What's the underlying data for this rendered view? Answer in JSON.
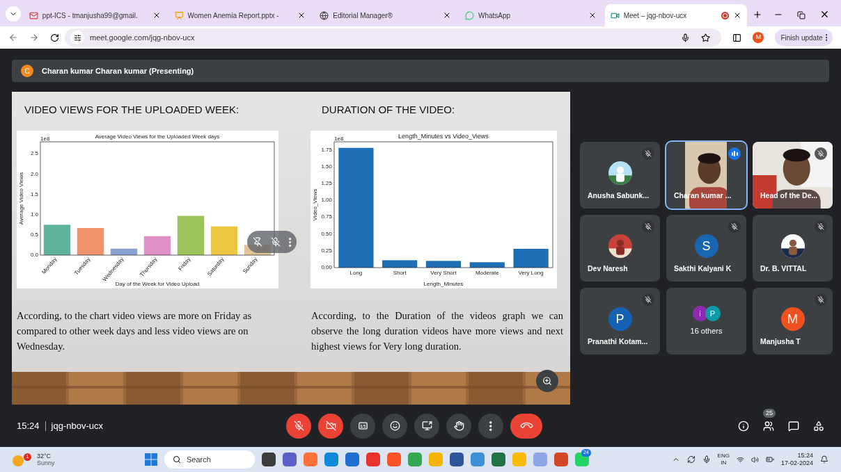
{
  "browser": {
    "tabs": [
      {
        "title": "ppt-ICS - tmanjusha99@gmail.",
        "kind": "mail",
        "selected": false
      },
      {
        "title": "Women Anemia Report.pptx -",
        "kind": "slides",
        "selected": false
      },
      {
        "title": "Editorial Manager®",
        "kind": "globe",
        "selected": false
      },
      {
        "title": "WhatsApp",
        "kind": "chat",
        "selected": false
      },
      {
        "title": "Meet – jqg-nbov-ucx",
        "kind": "meet",
        "selected": true,
        "recording": true
      }
    ],
    "url": "meet.google.com/jqg-nbov-ucx",
    "profile": "M",
    "update_button": "Finish update"
  },
  "presenter": {
    "initial": "C",
    "label": "Charan kumar Charan kumar (Presenting)"
  },
  "slide": {
    "sections": [
      {
        "heading": "VIDEO VIEWS FOR THE UPLOADED WEEK:",
        "body": "According, to the chart video views are more on Friday as compared to other week days and less video views are on Wednesday.",
        "justify": false,
        "chart_data": {
          "type": "bar",
          "title": "Average Video Views for the Uploaded Week days",
          "xlabel": "Day of the Week for Video Upload",
          "ylabel": "Average Video Views",
          "annotations": [
            {
              "text": "1e8"
            }
          ],
          "categories": [
            "Monday",
            "Tuesday",
            "Wednesday",
            "Thursday",
            "Friday",
            "Saturday",
            "Sunday"
          ],
          "series": [
            {
              "values": [
                0.75,
                0.67,
                0.16,
                0.47,
                0.97,
                0.71,
                0.25
              ]
            }
          ],
          "colors": [
            "#5fb49c",
            "#f0926a",
            "#8aa2cf",
            "#e092c8",
            "#9bc55a",
            "#eec740",
            "#e3c496"
          ],
          "ylim": [
            0,
            2.8
          ],
          "yticks": [
            {
              "value": 0,
              "label": "0.0"
            },
            {
              "value": 0.5,
              "label": "0.5"
            },
            {
              "value": 1,
              "label": "1.0"
            },
            {
              "value": 1.5,
              "label": "1.5"
            },
            {
              "value": 2,
              "label": "2.0"
            },
            {
              "value": 2.5,
              "label": "2.5"
            }
          ]
        }
      },
      {
        "heading": "DURATION OF THE VIDEO:",
        "body": "According, to the Duration of the videos graph we can observe the long duration videos have more views and next highest views for Very long duration.",
        "justify": true,
        "chart_data": {
          "type": "bar",
          "title": "Length_Minutes vs Video_Views",
          "xlabel": "Length_Minutes",
          "ylabel": "Video_Views",
          "annotations": [
            {
              "text": "1e8"
            }
          ],
          "categories": [
            "Long",
            "Short",
            "Very Short",
            "Moderate",
            "Very Long"
          ],
          "series": [
            {
              "color": "#1f6fb4",
              "values": [
                1.78,
                0.11,
                0.1,
                0.08,
                0.28
              ]
            }
          ],
          "ylim": [
            0,
            1.87
          ],
          "yticks": [
            {
              "value": 0,
              "label": "0.00"
            },
            {
              "value": 0.25,
              "label": "0.25"
            },
            {
              "value": 0.5,
              "label": "0.50"
            },
            {
              "value": 0.75,
              "label": "0.75"
            },
            {
              "value": 1,
              "label": "1.00"
            },
            {
              "value": 1.25,
              "label": "1.25"
            },
            {
              "value": 1.5,
              "label": "1.50"
            },
            {
              "value": 1.75,
              "label": "1.75"
            }
          ]
        }
      }
    ]
  },
  "participants": [
    {
      "name": "Anusha Sabunk...",
      "muted": true,
      "speaking": false
    },
    {
      "name": "Charan kumar ...",
      "kind": "video",
      "muted": false,
      "speaking": true
    },
    {
      "name": "Head of the De...",
      "kind": "fullvideo",
      "muted": true,
      "speaking": false
    },
    {
      "name": "Dev Naresh",
      "muted": true,
      "speaking": false
    },
    {
      "name": "Sakthi Kalyani K",
      "kind": "letter",
      "initial": "S",
      "color": "#1a65b0",
      "muted": true,
      "speaking": false
    },
    {
      "name": "Dr. B. VITTAL",
      "muted": true,
      "speaking": false
    },
    {
      "name": "Pranathi Kotam...",
      "kind": "letter",
      "initial": "P",
      "color": "#1561b3",
      "muted": true,
      "speaking": false
    },
    {
      "name": "16 others",
      "kind": "others",
      "avatars": [
        {
          "initial": "i",
          "color": "#8e2ab0"
        },
        {
          "initial": "P",
          "color": "#0f9aa8"
        }
      ],
      "muted": false,
      "speaking": false
    },
    {
      "name": "Manjusha T",
      "kind": "letter",
      "initial": "M",
      "color": "#f0511e",
      "muted": true,
      "speaking": false
    }
  ],
  "toolbar": {
    "time": "15:24",
    "meeting_code": "jqg-nbov-ucx",
    "people_count": "25",
    "buttons": [
      {
        "kind": "mic",
        "off": true
      },
      {
        "kind": "camera",
        "off": true
      },
      {
        "kind": "captions",
        "off": false
      },
      {
        "kind": "emoji",
        "off": false
      },
      {
        "kind": "present",
        "off": false
      },
      {
        "kind": "hand",
        "off": false
      },
      {
        "kind": "more",
        "off": false
      },
      {
        "kind": "hangup"
      }
    ]
  },
  "taskbar": {
    "weather": {
      "temp": "32°C",
      "condition": "Sunny",
      "badge": "1"
    },
    "search_placeholder": "Search",
    "apps": [
      {
        "color": "#3c3c3c"
      },
      {
        "color": "#5b5fc7"
      },
      {
        "color": "#ff7139"
      },
      {
        "color": "#0f8ad8"
      },
      {
        "color": "#1e6fd0"
      },
      {
        "color": "#e8322c"
      },
      {
        "color": "#fb542b"
      },
      {
        "color": "#34a853"
      },
      {
        "color": "#f4b400"
      },
      {
        "color": "#2b579a"
      },
      {
        "color": "#3f8fd6"
      },
      {
        "color": "#217346"
      },
      {
        "color": "#fbbc05"
      },
      {
        "color": "#8ea6e8"
      },
      {
        "color": "#d24726"
      },
      {
        "color": "#25d366",
        "badge": "24"
      }
    ],
    "tray": {
      "language": "ENG",
      "region": "IN",
      "time": "15:24",
      "date": "17-02-2024"
    }
  }
}
